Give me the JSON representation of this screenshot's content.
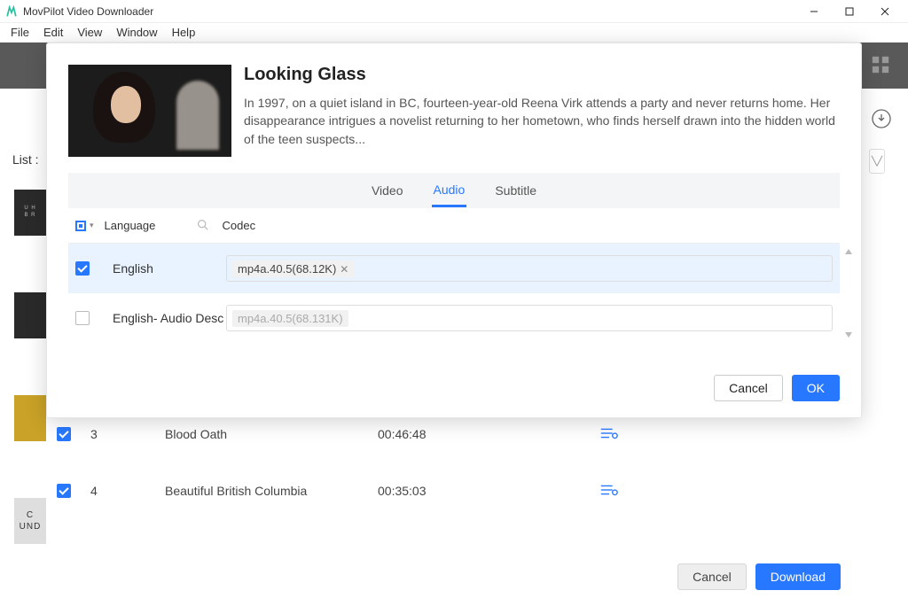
{
  "window": {
    "title": "MovPilot Video Downloader"
  },
  "menu": {
    "file": "File",
    "edit": "Edit",
    "view": "View",
    "window": "Window",
    "help": "Help"
  },
  "bg": {
    "list_label": "List :",
    "rows": [
      {
        "idx": "3",
        "title": "Blood Oath",
        "duration": "00:46:48"
      },
      {
        "idx": "4",
        "title": "Beautiful British Columbia",
        "duration": "00:35:03"
      }
    ],
    "cancel": "Cancel",
    "download": "Download",
    "thumb4_text": "C\nUND"
  },
  "modal": {
    "title": "Looking Glass",
    "desc": "In 1997, on a quiet island in BC, fourteen-year-old Reena Virk attends a party and never returns home. Her disappearance intrigues a novelist returning to her hometown, who finds herself drawn into the hidden world of the teen suspects...",
    "tabs": {
      "video": "Video",
      "audio": "Audio",
      "subtitle": "Subtitle"
    },
    "cols": {
      "language": "Language",
      "codec": "Codec"
    },
    "rows": [
      {
        "lang": "English",
        "chip": "mp4a.40.5(68.12K)",
        "selected": true
      },
      {
        "lang": "English- Audio Desc",
        "chip": "mp4a.40.5(68.131K)",
        "selected": false
      }
    ],
    "footer": {
      "cancel": "Cancel",
      "ok": "OK"
    }
  }
}
